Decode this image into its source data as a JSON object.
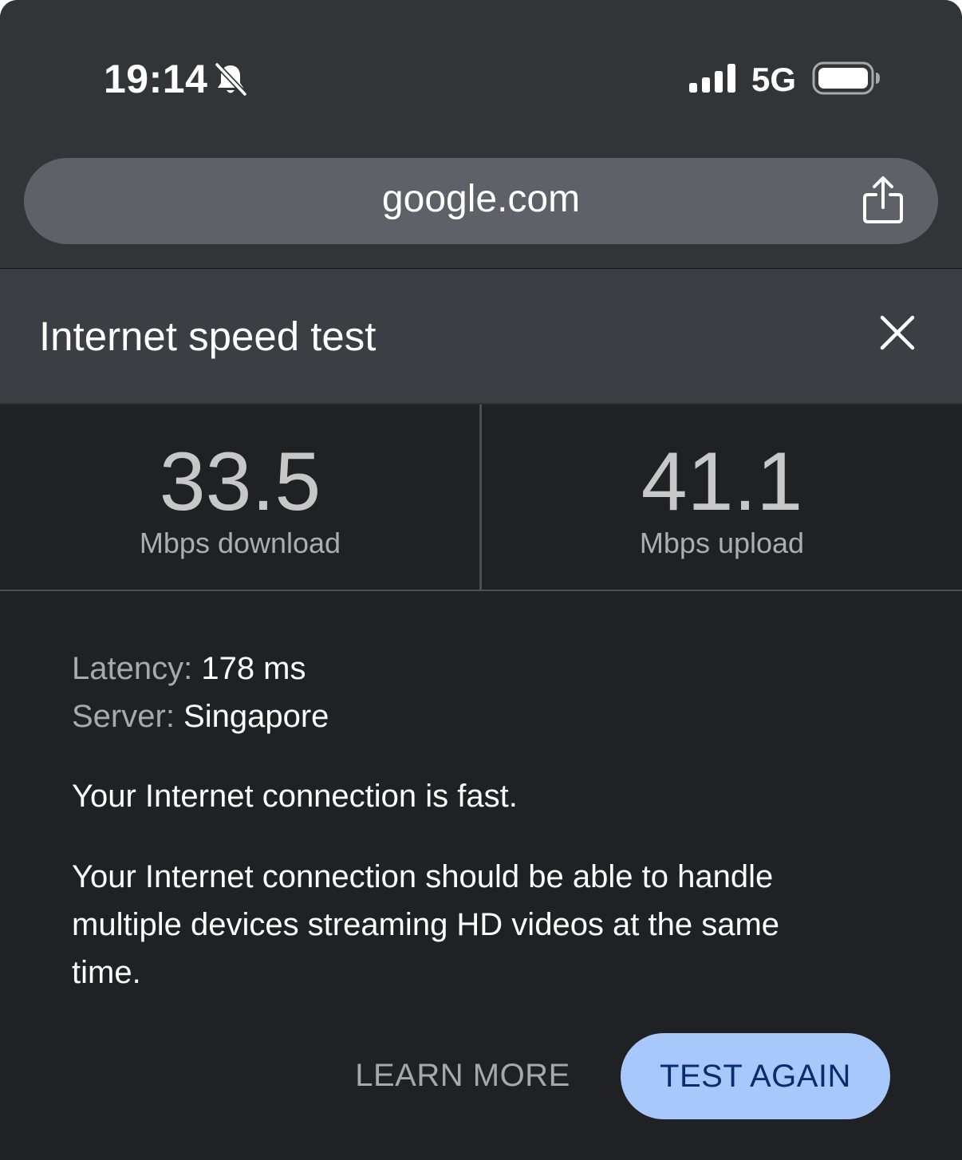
{
  "status_bar": {
    "time": "19:14",
    "network": "5G",
    "icons": [
      "bell-off-icon",
      "signal-bars-icon",
      "battery-icon"
    ]
  },
  "browser": {
    "url": "google.com",
    "share_icon": "share-icon"
  },
  "speed_test": {
    "title": "Internet speed test",
    "close_icon": "close-icon",
    "download": {
      "value": "33.5",
      "label": "Mbps download"
    },
    "upload": {
      "value": "41.1",
      "label": "Mbps upload"
    },
    "latency": {
      "label": "Latency:",
      "value": "178 ms"
    },
    "server": {
      "label": "Server:",
      "value": "Singapore"
    },
    "summary": "Your Internet connection is fast.",
    "description": "Your Internet connection should be able to handle multiple devices streaming HD videos at the same time.",
    "actions": {
      "learn_more": "LEARN MORE",
      "test_again": "TEST AGAIN"
    }
  },
  "colors": {
    "background": "#202124",
    "chrome": "#323538",
    "header": "#3b3e42",
    "url_bar": "#5e6168",
    "primary_button": "#a8c7fa",
    "primary_button_text": "#062e6f"
  }
}
